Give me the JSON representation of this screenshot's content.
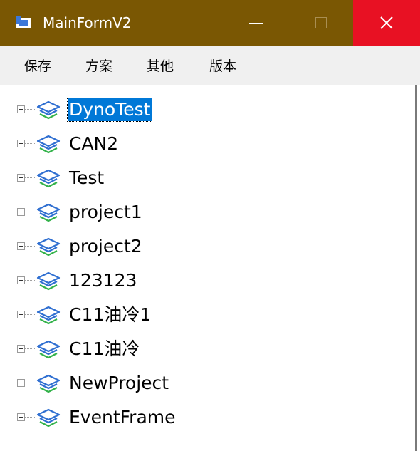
{
  "window": {
    "title": "MainFormV2",
    "icon": "app-window-icon",
    "titlebar_color": "#7a5703",
    "close_color": "#e81123"
  },
  "menu": {
    "items": [
      {
        "label": "保存"
      },
      {
        "label": "方案"
      },
      {
        "label": "其他"
      },
      {
        "label": "版本"
      }
    ]
  },
  "tree": {
    "node_icon": "layers-icon",
    "selected_color": "#0078d7",
    "nodes": [
      {
        "label": "DynoTest",
        "selected": true
      },
      {
        "label": "CAN2"
      },
      {
        "label": "Test"
      },
      {
        "label": "project1"
      },
      {
        "label": "project2"
      },
      {
        "label": "123123"
      },
      {
        "label": "C11油冷1"
      },
      {
        "label": "C11油冷"
      },
      {
        "label": "NewProject"
      },
      {
        "label": "EventFrame"
      }
    ]
  }
}
